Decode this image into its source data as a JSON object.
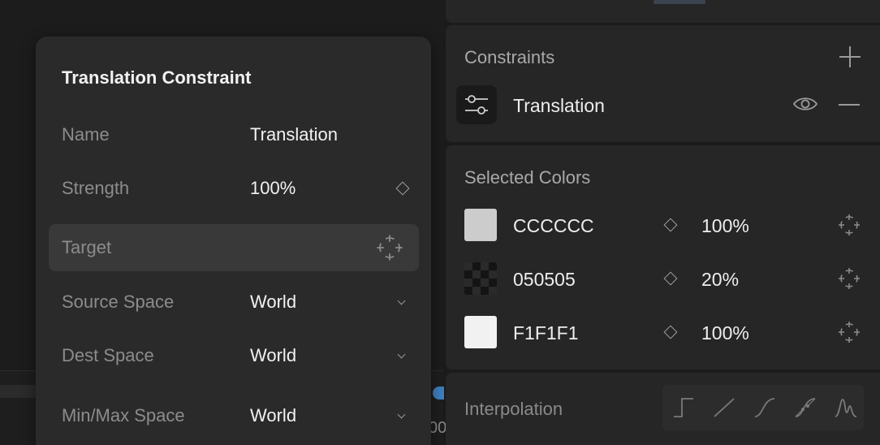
{
  "popover": {
    "title": "Translation Constraint",
    "rows": [
      {
        "label": "Name",
        "value": "Translation"
      },
      {
        "label": "Strength",
        "value": "100%"
      },
      {
        "label": "Target",
        "value": ""
      },
      {
        "label": "Source Space",
        "value": "World"
      },
      {
        "label": "Dest Space",
        "value": "World"
      },
      {
        "label": "Min/Max Space",
        "value": "World"
      }
    ]
  },
  "constraints": {
    "title": "Constraints",
    "items": [
      {
        "label": "Translation",
        "icon": "sliders-icon"
      }
    ]
  },
  "selected_colors": {
    "title": "Selected Colors",
    "items": [
      {
        "hex": "CCCCCC",
        "opacity": "100%",
        "swatch": "#cccccc"
      },
      {
        "hex": "050505",
        "opacity": "20%",
        "swatch": "#050505"
      },
      {
        "hex": "F1F1F1",
        "opacity": "100%",
        "swatch": "#f1f1f1"
      }
    ]
  },
  "interpolation": {
    "title": "Interpolation",
    "modes": [
      "hold-icon",
      "linear-icon",
      "cubic-icon",
      "custom-bezier-icon",
      "elastic-icon"
    ]
  },
  "timeline": {
    "visible_number": "00"
  },
  "colors": {
    "accent": "#3f7fc0",
    "panel": "#262626",
    "popover": "#2a2a2a"
  }
}
